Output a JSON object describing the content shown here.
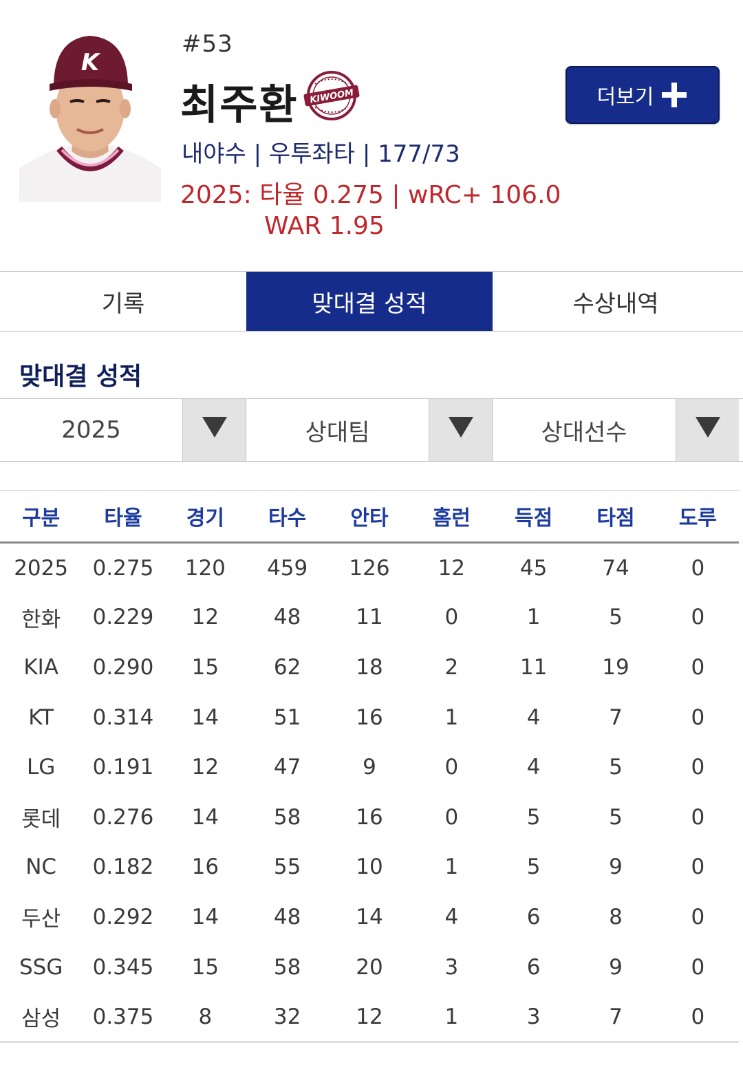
{
  "player": {
    "number": "#53",
    "name": "최주환",
    "team_logo_text": "KIWOOM",
    "bio": "내야수 | 우투좌타 | 177/73",
    "stat_line": "2025: 타율 0.275 | wRC+ 106.0",
    "war_line": "WAR 1.95",
    "photo_icon": "player-photo"
  },
  "more_button": {
    "label": "더보기",
    "icon": "plus-icon"
  },
  "tabs": [
    {
      "label": "기록",
      "active": false
    },
    {
      "label": "맞대결 성적",
      "active": true
    },
    {
      "label": "수상내역",
      "active": false
    }
  ],
  "section_title": "맞대결 성적",
  "filters": [
    {
      "value": "2025",
      "icon": "caret-down-icon"
    },
    {
      "value": "상대팀",
      "icon": "caret-down-icon"
    },
    {
      "value": "상대선수",
      "icon": "caret-down-icon"
    }
  ],
  "table": {
    "headers": [
      "구분",
      "타율",
      "경기",
      "타수",
      "안타",
      "홈런",
      "득점",
      "타점",
      "도루"
    ],
    "rows": [
      [
        "2025",
        "0.275",
        "120",
        "459",
        "126",
        "12",
        "45",
        "74",
        "0"
      ],
      [
        "한화",
        "0.229",
        "12",
        "48",
        "11",
        "0",
        "1",
        "5",
        "0"
      ],
      [
        "KIA",
        "0.290",
        "15",
        "62",
        "18",
        "2",
        "11",
        "19",
        "0"
      ],
      [
        "KT",
        "0.314",
        "14",
        "51",
        "16",
        "1",
        "4",
        "7",
        "0"
      ],
      [
        "LG",
        "0.191",
        "12",
        "47",
        "9",
        "0",
        "4",
        "5",
        "0"
      ],
      [
        "롯데",
        "0.276",
        "14",
        "58",
        "16",
        "0",
        "5",
        "5",
        "0"
      ],
      [
        "NC",
        "0.182",
        "16",
        "55",
        "10",
        "1",
        "5",
        "9",
        "0"
      ],
      [
        "두산",
        "0.292",
        "14",
        "48",
        "14",
        "4",
        "6",
        "8",
        "0"
      ],
      [
        "SSG",
        "0.345",
        "15",
        "58",
        "20",
        "3",
        "6",
        "9",
        "0"
      ],
      [
        "삼성",
        "0.375",
        "8",
        "32",
        "12",
        "1",
        "3",
        "7",
        "0"
      ]
    ]
  },
  "colors": {
    "navy": "#162c8a",
    "header_blue": "#1d3b9e",
    "stat_red": "#c0272d",
    "team_burgundy": "#8a1c3a"
  }
}
